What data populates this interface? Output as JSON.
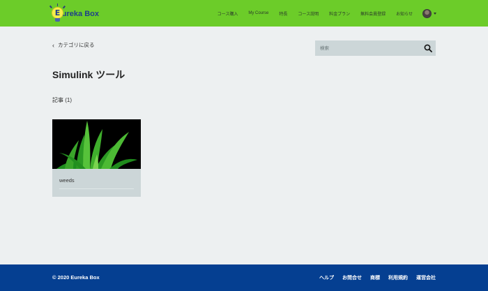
{
  "header": {
    "logo_letter": "E",
    "logo_text": "ureka Box",
    "nav": [
      "コース購入",
      "My Course",
      "特長",
      "コース説明",
      "料金プラン",
      "無料会員登録",
      "お知らせ"
    ]
  },
  "main": {
    "back_link": "カテゴリに戻る",
    "search_placeholder": "検索",
    "title": "Simulink ツール",
    "count": "記事 (1)",
    "card": {
      "title": "weeds"
    }
  },
  "footer": {
    "copyright": "© 2020 Eureka Box",
    "links": [
      "ヘルプ",
      "お問合せ",
      "商標",
      "利用規約",
      "運営会社"
    ]
  },
  "colors": {
    "header_bg": "#6ccc29",
    "footer_bg": "#053f91",
    "page_bg": "#edf0f1",
    "search_bg": "#ccd6d8"
  },
  "icons": [
    "lightbulb-logo-icon",
    "chevron-left-icon",
    "search-icon",
    "avatar",
    "caret-down-icon"
  ]
}
